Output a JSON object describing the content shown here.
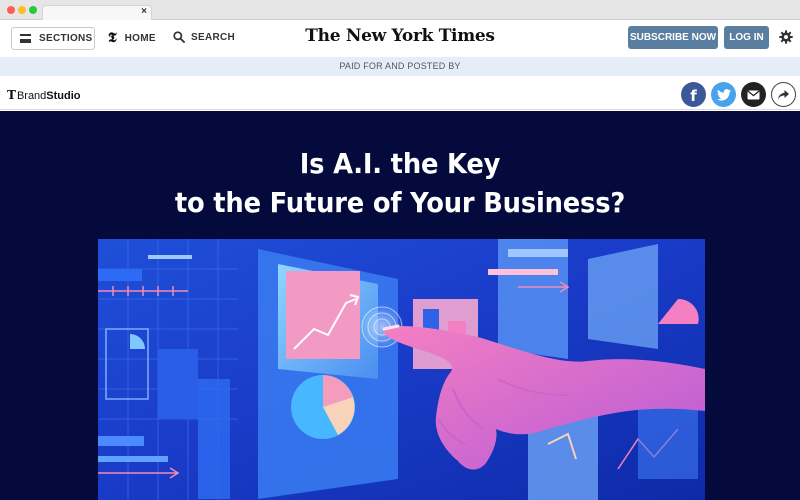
{
  "browser": {
    "tab_close": "×"
  },
  "header": {
    "sections_label": "SECTIONS",
    "home_label": "HOME",
    "search_label": "SEARCH",
    "masthead": "The New York Times",
    "subscribe_label": "SUBSCRIBE NOW",
    "login_label": "LOG IN",
    "home_icon": "nyt-t-logo-icon",
    "menu_icon": "hamburger-icon",
    "search_icon": "magnifier-icon",
    "settings_icon": "gear-icon",
    "button_color": "#5a7ea0"
  },
  "paid_strip": {
    "text": "PAID FOR AND POSTED BY",
    "background": "#e5eef8"
  },
  "brand_bar": {
    "logo_t": "T",
    "logo_word_a": "Brand",
    "logo_word_b": "Studio",
    "share_icons": [
      "facebook-icon",
      "twitter-icon",
      "email-icon",
      "share-arrow-icon"
    ],
    "facebook_glyph": "f",
    "colors": {
      "facebook": "#3b5998",
      "twitter": "#4aa1ec",
      "email": "#222222"
    }
  },
  "hero": {
    "headline_line1": "Is A.I. the Key",
    "headline_line2": "to the Future of Your Business?",
    "background": "#040a3b",
    "illustration": "hand-touching-holographic-data-dashboard"
  }
}
